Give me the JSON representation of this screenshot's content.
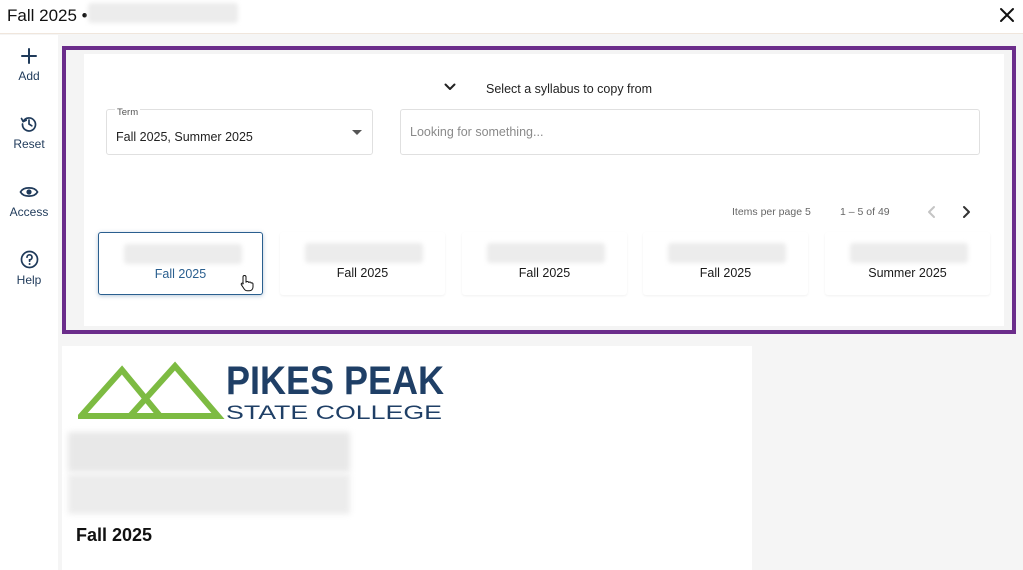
{
  "window": {
    "title": "Fall 2025 •"
  },
  "sidebar": {
    "items": [
      {
        "label": "Add",
        "icon": "plus-icon"
      },
      {
        "label": "Reset",
        "icon": "history-icon"
      },
      {
        "label": "Access",
        "icon": "eye-icon"
      },
      {
        "label": "Help",
        "icon": "help-circle-icon"
      }
    ]
  },
  "panel": {
    "heading": "Select a syllabus to copy from",
    "term_field": {
      "label": "Term",
      "value": "Fall 2025, Summer 2025"
    },
    "search": {
      "placeholder": "Looking for something..."
    },
    "pager": {
      "items_per_page": "Items per page 5",
      "range": "1 – 5 of 49"
    },
    "cards": [
      {
        "label": "Fall 2025",
        "selected": true
      },
      {
        "label": "Fall 2025",
        "selected": false
      },
      {
        "label": "Fall 2025",
        "selected": false
      },
      {
        "label": "Fall 2025",
        "selected": false
      },
      {
        "label": "Summer 2025",
        "selected": false
      }
    ]
  },
  "document": {
    "logo": {
      "line1": "PIKES PEAK",
      "line2": "STATE COLLEGE"
    },
    "term_title": "Fall 2025"
  },
  "colors": {
    "accent_border": "#6b2d8b",
    "selected_card": "#2a5f8f",
    "logo_blue": "#1f3f66",
    "logo_green": "#7dbb42"
  }
}
